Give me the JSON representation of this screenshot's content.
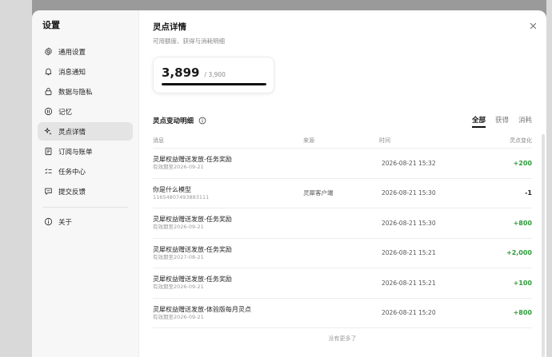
{
  "sidebar": {
    "title": "设置",
    "items": [
      {
        "label": "通用设置",
        "icon": "gear-icon"
      },
      {
        "label": "消息通知",
        "icon": "bell-icon"
      },
      {
        "label": "数据与隐私",
        "icon": "lock-icon"
      },
      {
        "label": "记忆",
        "icon": "memory-icon"
      },
      {
        "label": "灵点详情",
        "icon": "sparkle-icon",
        "active": true
      },
      {
        "label": "订阅与账单",
        "icon": "receipt-icon"
      },
      {
        "label": "任务中心",
        "icon": "task-icon"
      },
      {
        "label": "提交反馈",
        "icon": "feedback-icon"
      }
    ],
    "about": {
      "label": "关于",
      "icon": "info-icon"
    }
  },
  "main": {
    "title": "灵点详情",
    "subtitle": "可用额度、获得与消耗明细",
    "balance": {
      "value": "3,899",
      "total": "/ 3,900",
      "ratio": 0.9997
    },
    "section_title": "灵点变动明细",
    "filters": [
      {
        "label": "全部",
        "active": true
      },
      {
        "label": "获得",
        "active": false
      },
      {
        "label": "消耗",
        "active": false
      }
    ],
    "columns": {
      "msg": "消息",
      "src": "来源",
      "time": "时间",
      "chg": "灵点变化"
    },
    "rows": [
      {
        "title": "灵犀权益赠送发放-任务奖励",
        "sub": "有效期至2026-09-21",
        "src": "",
        "time": "2026-08-21 15:32",
        "chg": "+200",
        "positive": true
      },
      {
        "title": "你是什么模型",
        "sub": "11654807493883111",
        "src": "灵犀客户端",
        "time": "2026-08-21 15:30",
        "chg": "-1",
        "positive": false
      },
      {
        "title": "灵犀权益赠送发放-任务奖励",
        "sub": "有效期至2026-09-21",
        "src": "",
        "time": "2026-08-21 15:30",
        "chg": "+800",
        "positive": true
      },
      {
        "title": "灵犀权益赠送发放-任务奖励",
        "sub": "有效期至2027-08-21",
        "src": "",
        "time": "2026-08-21 15:21",
        "chg": "+2,000",
        "positive": true
      },
      {
        "title": "灵犀权益赠送发放-任务奖励",
        "sub": "有效期至2026-09-21",
        "src": "",
        "time": "2026-08-21 15:21",
        "chg": "+100",
        "positive": true
      },
      {
        "title": "灵犀权益赠送发放-体验版每月灵点",
        "sub": "有效期至2026-09-21",
        "src": "",
        "time": "2026-08-21 15:20",
        "chg": "+800",
        "positive": true
      }
    ],
    "no_more": "没有更多了"
  },
  "colors": {
    "positive": "#2e9b3a",
    "active_nav": "#e4e4e4"
  }
}
